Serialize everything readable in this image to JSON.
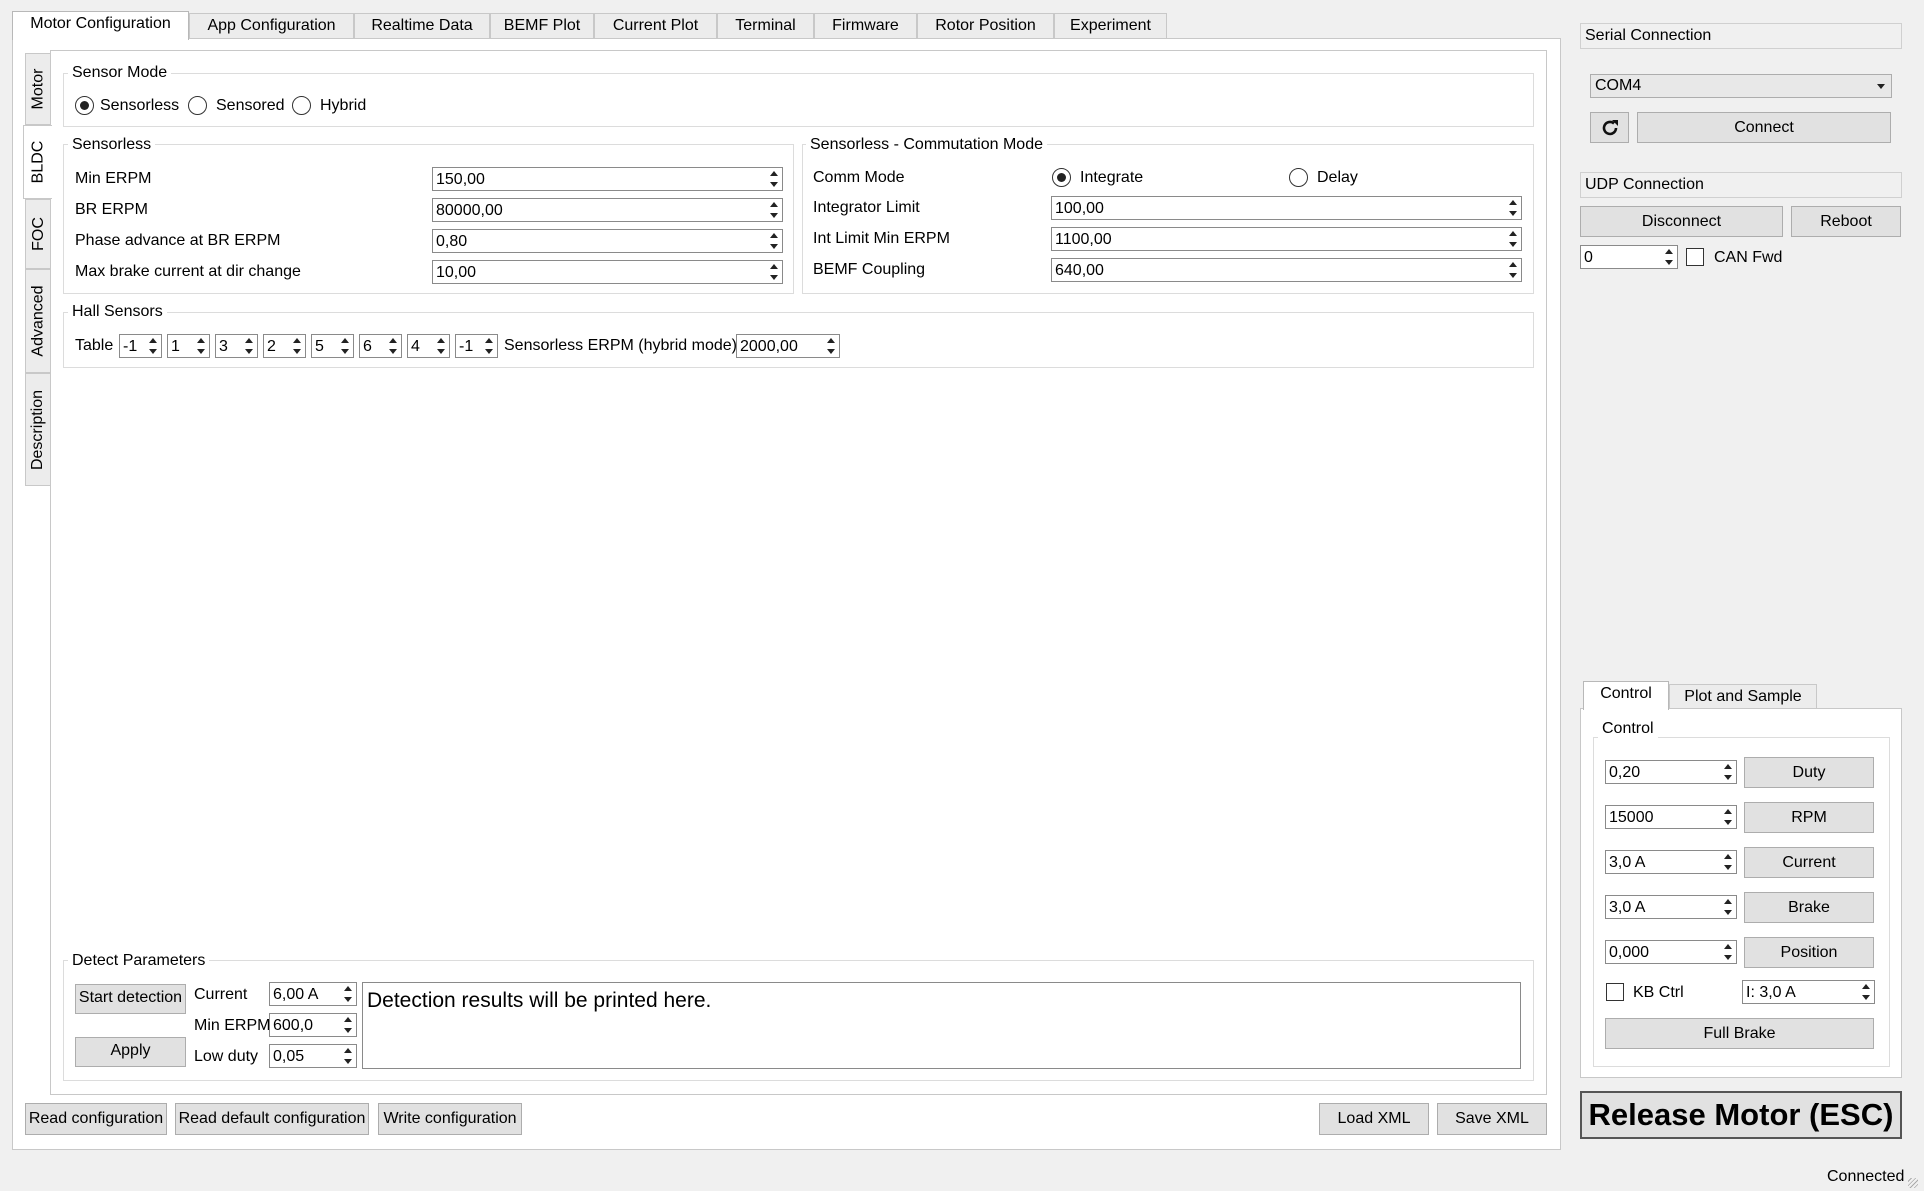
{
  "top_tabs": [
    "Motor Configuration",
    "App Configuration",
    "Realtime Data",
    "BEMF Plot",
    "Current Plot",
    "Terminal",
    "Firmware",
    "Rotor Position",
    "Experiment"
  ],
  "side_tabs": [
    "Motor",
    "BLDC",
    "FOC",
    "Advanced",
    "Description"
  ],
  "sensor_mode": {
    "title": "Sensor Mode",
    "options": [
      "Sensorless",
      "Sensored",
      "Hybrid"
    ],
    "selected": "Sensorless"
  },
  "sensorless": {
    "title": "Sensorless",
    "rows": [
      {
        "label": "Min ERPM",
        "value": "150,00"
      },
      {
        "label": "BR ERPM",
        "value": "80000,00"
      },
      {
        "label": "Phase advance at BR ERPM",
        "value": "0,80"
      },
      {
        "label": "Max brake current at dir change",
        "value": "10,00"
      }
    ]
  },
  "commutation": {
    "title": "Sensorless - Commutation Mode",
    "comm_label": "Comm Mode",
    "options": [
      "Integrate",
      "Delay"
    ],
    "selected": "Integrate",
    "rows": [
      {
        "label": "Integrator Limit",
        "value": "100,00"
      },
      {
        "label": "Int Limit Min ERPM",
        "value": "1100,00"
      },
      {
        "label": "BEMF Coupling",
        "value": "640,00"
      }
    ]
  },
  "hall": {
    "title": "Hall Sensors",
    "table_label": "Table",
    "table": [
      "-1",
      "1",
      "3",
      "2",
      "5",
      "6",
      "4",
      "-1"
    ],
    "erpm_label": "Sensorless ERPM (hybrid mode)",
    "erpm_value": "2000,00"
  },
  "detect": {
    "title": "Detect Parameters",
    "start_label": "Start detection",
    "apply_label": "Apply",
    "current_label": "Current",
    "current_value": "6,00 A",
    "min_erpm_label": "Min ERPM",
    "min_erpm_value": "600,0",
    "low_duty_label": "Low duty",
    "low_duty_value": "0,05",
    "results": "Detection results will be printed here."
  },
  "bottom_buttons": {
    "read": "Read configuration",
    "read_default": "Read default configuration",
    "write": "Write configuration",
    "load": "Load XML",
    "save": "Save XML"
  },
  "serial": {
    "title": "Serial Connection",
    "port": "COM4",
    "connect": "Connect"
  },
  "udp": {
    "title": "UDP Connection",
    "disconnect": "Disconnect",
    "reboot": "Reboot",
    "can_id": "0",
    "can_fwd": "CAN Fwd"
  },
  "control_tabs": [
    "Control",
    "Plot and Sample"
  ],
  "control": {
    "title": "Control",
    "rows": [
      {
        "value": "0,20",
        "button": "Duty"
      },
      {
        "value": "15000",
        "button": "RPM"
      },
      {
        "value": "3,0 A",
        "button": "Current"
      },
      {
        "value": "3,0 A",
        "button": "Brake"
      },
      {
        "value": "0,000",
        "button": "Position"
      }
    ],
    "kb_ctrl": "KB Ctrl",
    "kb_current": "I: 3,0 A",
    "full_brake": "Full Brake"
  },
  "release": "Release Motor (ESC)",
  "status": "Connected"
}
